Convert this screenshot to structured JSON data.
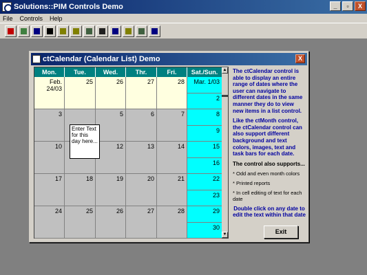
{
  "app": {
    "title": "Solutions::PIM Controls Demo",
    "window_buttons": [
      "_",
      "▫",
      "X"
    ]
  },
  "menu": [
    "File",
    "Controls",
    "Help"
  ],
  "toolbar": {
    "buttons": [
      {
        "icon": "calendar-red-icon",
        "color": "#c00000"
      },
      {
        "icon": "calendar-month-icon",
        "color": "#408040"
      },
      {
        "icon": "pim-icon",
        "color": "#000080"
      },
      {
        "icon": "hourglass-icon",
        "color": "#000000"
      },
      {
        "icon": "calendar-list-icon",
        "color": "#808000"
      },
      {
        "icon": "year-view-icon",
        "color": "#808000"
      },
      {
        "icon": "day-view-icon",
        "color": "#406040"
      },
      {
        "icon": "grid-icon",
        "color": "#202020"
      },
      {
        "icon": "schedule-icon",
        "color": "#000080"
      },
      {
        "icon": "number-icon",
        "color": "#808000"
      },
      {
        "icon": "window-icon",
        "color": "#406040"
      },
      {
        "icon": "list-icon",
        "color": "#000080"
      }
    ]
  },
  "dialog": {
    "title": "ctCalendar (Calendar List) Demo",
    "close": "X",
    "exit_label": "Exit"
  },
  "calendar": {
    "headers": [
      "Mon.",
      "Tue.",
      "Wed.",
      "Thr.",
      "Fri.",
      "Sat./Sun."
    ],
    "weeks": [
      {
        "days": [
          "Feb. 24/03",
          "25",
          "26",
          "27",
          "28"
        ],
        "sat": "Mar. 1/03",
        "sun": "2",
        "current": true
      },
      {
        "days": [
          "3",
          "",
          "5",
          "6",
          "7"
        ],
        "sat": "8",
        "sun": "9",
        "current": false
      },
      {
        "days": [
          "10",
          "11",
          "12",
          "13",
          "14"
        ],
        "sat": "15",
        "sun": "16",
        "current": false
      },
      {
        "days": [
          "17",
          "18",
          "19",
          "20",
          "21"
        ],
        "sat": "22",
        "sun": "23",
        "current": false
      },
      {
        "days": [
          "24",
          "25",
          "26",
          "27",
          "28"
        ],
        "sat": "29",
        "sun": "30",
        "current": false
      }
    ],
    "edit_text": "Enter Text for this day here..."
  },
  "description": {
    "p1": "The ctCalendar control is able to display an entire range of dates where the user can navigate to different dates in the same manner they do to view new items in a list control.",
    "p2": "Like the ctMonth control, the ctCalendar control can also support different background and text colors, images, text and task bars for each date.",
    "p3": "The control also supports...",
    "bullets": [
      "* Odd and even month colors",
      "* Printed reports",
      "* In cell editing of text for each date"
    ],
    "p4": "Double click on any date to edit the text within that date"
  },
  "colors": {
    "header": "#008080",
    "current_month": "#ffffe0",
    "other_month": "#c0c0c0",
    "weekend": "#00ffff",
    "description_text": "#0000a0",
    "title_bar": "#0a246a"
  }
}
